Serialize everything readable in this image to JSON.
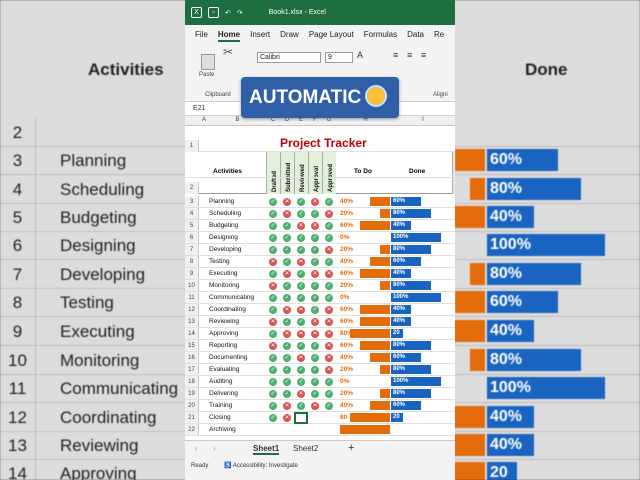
{
  "window": {
    "file_title": "Book1.xlsx",
    "app_name": "Excel"
  },
  "menu": [
    "File",
    "Home",
    "Insert",
    "Draw",
    "Page Layout",
    "Formulas",
    "Data",
    "Re"
  ],
  "ribbon": {
    "paste_label": "Paste",
    "clipboard_label": "Clipboard",
    "font_name": "Calibri",
    "font_size": "9",
    "alignment_label": "Aligni"
  },
  "namebox": "E21",
  "overlay_text": "AUTOMATIC",
  "sheet": {
    "title": "Project Tracker",
    "col_letters": [
      "A",
      "B",
      "C",
      "D",
      "E",
      "F",
      "G",
      "H",
      "I"
    ],
    "headers": {
      "activities": "Activities",
      "drafted": "Drafted",
      "submitted": "Submitted",
      "reviewed": "Reviewed",
      "approval": "Approval",
      "approved": "Approved",
      "todo": "To Do",
      "done": "Done"
    },
    "rows": [
      {
        "n": "3",
        "name": "Planning",
        "s": [
          1,
          0,
          1,
          0,
          1
        ],
        "todo": "40%",
        "tv": 40,
        "done": "60%",
        "dv": 60
      },
      {
        "n": "4",
        "name": "Scheduling",
        "s": [
          1,
          0,
          1,
          1,
          0
        ],
        "todo": "20%",
        "tv": 20,
        "done": "80%",
        "dv": 80
      },
      {
        "n": "5",
        "name": "Budgeting",
        "s": [
          1,
          1,
          0,
          0,
          1
        ],
        "todo": "60%",
        "tv": 60,
        "done": "40%",
        "dv": 40
      },
      {
        "n": "6",
        "name": "Designing",
        "s": [
          1,
          1,
          1,
          1,
          1
        ],
        "todo": "0%",
        "tv": 0,
        "done": "100%",
        "dv": 100
      },
      {
        "n": "7",
        "name": "Developing",
        "s": [
          1,
          1,
          1,
          1,
          0
        ],
        "todo": "20%",
        "tv": 20,
        "done": "80%",
        "dv": 80
      },
      {
        "n": "8",
        "name": "Testing",
        "s": [
          0,
          1,
          0,
          1,
          1
        ],
        "todo": "40%",
        "tv": 40,
        "done": "60%",
        "dv": 60
      },
      {
        "n": "9",
        "name": "Executing",
        "s": [
          1,
          0,
          1,
          0,
          0
        ],
        "todo": "60%",
        "tv": 60,
        "done": "40%",
        "dv": 40
      },
      {
        "n": "10",
        "name": "Monitoring",
        "s": [
          0,
          1,
          1,
          1,
          1
        ],
        "todo": "20%",
        "tv": 20,
        "done": "80%",
        "dv": 80
      },
      {
        "n": "11",
        "name": "Communicating",
        "s": [
          1,
          1,
          1,
          1,
          1
        ],
        "todo": "0%",
        "tv": 0,
        "done": "100%",
        "dv": 100
      },
      {
        "n": "12",
        "name": "Coordinating",
        "s": [
          1,
          0,
          0,
          1,
          0
        ],
        "todo": "60%",
        "tv": 60,
        "done": "40%",
        "dv": 40
      },
      {
        "n": "13",
        "name": "Reviewing",
        "s": [
          0,
          1,
          1,
          0,
          0
        ],
        "todo": "60%",
        "tv": 60,
        "done": "40%",
        "dv": 40
      },
      {
        "n": "14",
        "name": "Approving",
        "s": [
          1,
          0,
          0,
          0,
          0
        ],
        "todo": "80%",
        "tv": 80,
        "done": "20",
        "dv": 20
      },
      {
        "n": "15",
        "name": "Reporting",
        "s": [
          0,
          1,
          1,
          1,
          0
        ],
        "todo": "60%",
        "tv": 60,
        "done": "80%",
        "dv": 80
      },
      {
        "n": "16",
        "name": "Documenting",
        "s": [
          1,
          1,
          0,
          1,
          0
        ],
        "todo": "40%",
        "tv": 40,
        "done": "60%",
        "dv": 60
      },
      {
        "n": "17",
        "name": "Evaluating",
        "s": [
          1,
          1,
          1,
          1,
          0
        ],
        "todo": "20%",
        "tv": 20,
        "done": "80%",
        "dv": 80
      },
      {
        "n": "18",
        "name": "Auditing",
        "s": [
          1,
          1,
          1,
          1,
          1
        ],
        "todo": "0%",
        "tv": 0,
        "done": "100%",
        "dv": 100
      },
      {
        "n": "19",
        "name": "Delivering",
        "s": [
          1,
          1,
          0,
          1,
          1
        ],
        "todo": "20%",
        "tv": 20,
        "done": "80%",
        "dv": 80
      },
      {
        "n": "20",
        "name": "Training",
        "s": [
          1,
          0,
          1,
          0,
          1
        ],
        "todo": "40%",
        "tv": 40,
        "done": "60%",
        "dv": 60
      },
      {
        "n": "21",
        "name": "Closing",
        "s": [
          1,
          0,
          -1,
          -1,
          -1
        ],
        "todo": "80",
        "tv": 80,
        "done": "20",
        "dv": 20
      },
      {
        "n": "22",
        "name": "Archiving",
        "s": [
          -1,
          -1,
          -1,
          -1,
          -1
        ],
        "todo": "",
        "tv": 80,
        "done": "",
        "dv": 0
      }
    ]
  },
  "tabs": [
    "Sheet1",
    "Sheet2"
  ],
  "status": {
    "ready": "Ready",
    "accessibility": "Accessibility: Investigate"
  },
  "background": {
    "header_activities": "Activities",
    "header_done": "Done",
    "rows": [
      {
        "n": "2",
        "name": "",
        "done": ""
      },
      {
        "n": "3",
        "name": "Planning",
        "done": "60%"
      },
      {
        "n": "4",
        "name": "Scheduling",
        "done": "80%"
      },
      {
        "n": "5",
        "name": "Budgeting",
        "done": "40%"
      },
      {
        "n": "6",
        "name": "Designing",
        "done": "100%"
      },
      {
        "n": "7",
        "name": "Developing",
        "done": "80%"
      },
      {
        "n": "8",
        "name": "Testing",
        "done": "60%"
      },
      {
        "n": "9",
        "name": "Executing",
        "done": "40%"
      },
      {
        "n": "10",
        "name": "Monitoring",
        "done": "80%"
      },
      {
        "n": "11",
        "name": "Communicating",
        "done": "100%"
      },
      {
        "n": "12",
        "name": "Coordinating",
        "done": "40%"
      },
      {
        "n": "13",
        "name": "Reviewing",
        "done": "40%"
      },
      {
        "n": "14",
        "name": "Approving",
        "done": "20"
      }
    ]
  },
  "colors": {
    "todo": "#e46c0a",
    "done": "#1a64c1",
    "ok": "#4caf6e",
    "no": "#d9534f",
    "excel_green": "#1d6f42"
  }
}
